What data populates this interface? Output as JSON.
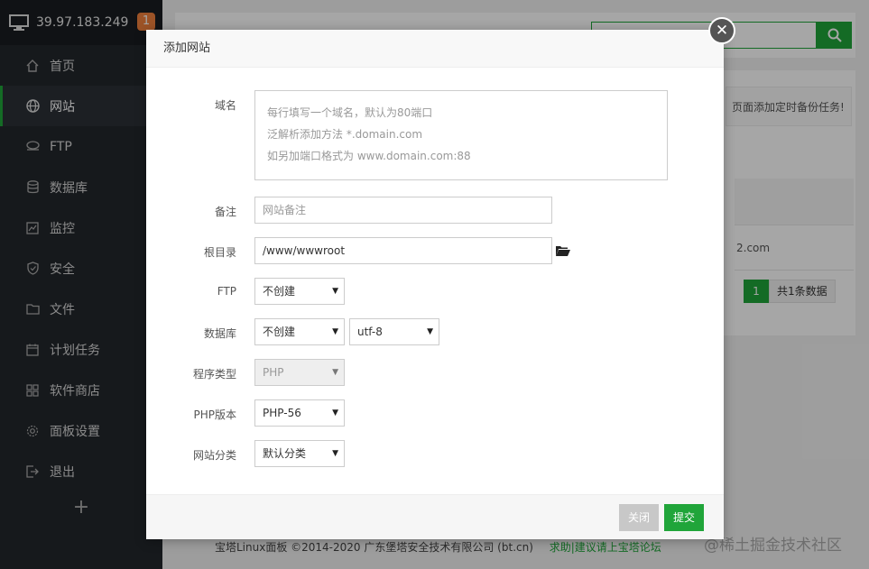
{
  "server": {
    "ip": "39.97.183.249",
    "badge": "1"
  },
  "sidebar": {
    "items": [
      {
        "label": "首页",
        "icon": "home-icon"
      },
      {
        "label": "网站",
        "icon": "globe-icon"
      },
      {
        "label": "FTP",
        "icon": "ftp-icon"
      },
      {
        "label": "数据库",
        "icon": "database-icon"
      },
      {
        "label": "监控",
        "icon": "monitor-chart-icon"
      },
      {
        "label": "安全",
        "icon": "shield-icon"
      },
      {
        "label": "文件",
        "icon": "folder-icon"
      },
      {
        "label": "计划任务",
        "icon": "calendar-icon"
      },
      {
        "label": "软件商店",
        "icon": "grid-icon"
      },
      {
        "label": "面板设置",
        "icon": "gear-icon"
      },
      {
        "label": "退出",
        "icon": "logout-icon"
      }
    ],
    "active_index": 1,
    "add_label": "+"
  },
  "background": {
    "tip_text": "页面添加定时备份任务!",
    "row_domain": "2.com",
    "pager_current": "1",
    "pager_total": "共1条数据"
  },
  "modal": {
    "title": "添加网站",
    "domain": {
      "label": "域名",
      "placeholder_lines": [
        "每行填写一个域名，默认为80端口",
        "泛解析添加方法 *.domain.com",
        "如另加端口格式为 www.domain.com:88"
      ]
    },
    "remark": {
      "label": "备注",
      "placeholder": "网站备注"
    },
    "root": {
      "label": "根目录",
      "value": "/www/wwwroot"
    },
    "ftp": {
      "label": "FTP",
      "selected": "不创建"
    },
    "database": {
      "label": "数据库",
      "selected": "不创建",
      "charset": "utf-8"
    },
    "program_type": {
      "label": "程序类型",
      "selected": "PHP"
    },
    "php_version": {
      "label": "PHP版本",
      "selected": "PHP-56"
    },
    "category": {
      "label": "网站分类",
      "selected": "默认分类"
    },
    "close_label": "关闭",
    "submit_label": "提交"
  },
  "footer": {
    "copyright": "宝塔Linux面板 ©2014-2020 广东堡塔安全技术有限公司 (bt.cn)",
    "link": "求助|建议请上宝塔论坛"
  },
  "watermark": "@稀土掘金技术社区",
  "colors": {
    "accent": "#20a53a",
    "sidebar_bg": "#23272c",
    "badge": "#f0803c"
  }
}
